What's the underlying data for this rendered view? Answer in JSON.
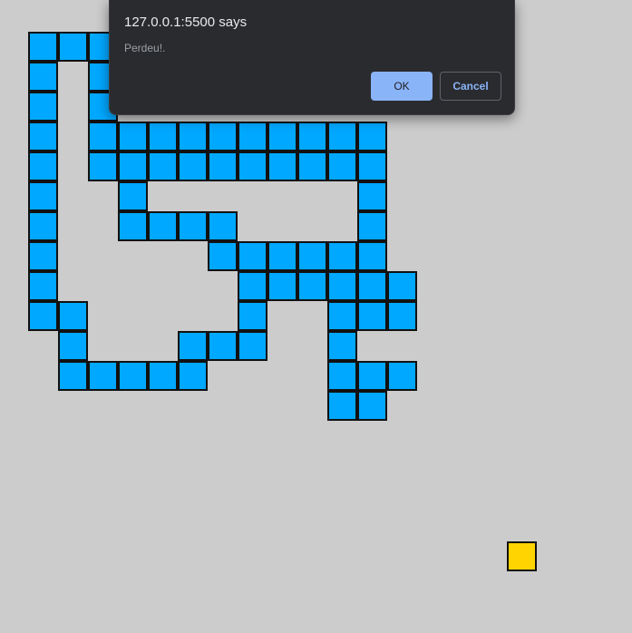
{
  "game": {
    "snake_color": "#00a8ff",
    "food_color": "#ffd400",
    "background_color": "#cccccc",
    "grid_origin": [
      31,
      35
    ],
    "cell_size": 33,
    "snake_cells": [
      [
        0,
        0
      ],
      [
        1,
        0
      ],
      [
        2,
        0
      ],
      [
        0,
        1
      ],
      [
        2,
        1
      ],
      [
        0,
        2
      ],
      [
        2,
        2
      ],
      [
        0,
        3
      ],
      [
        2,
        3
      ],
      [
        3,
        3
      ],
      [
        4,
        3
      ],
      [
        5,
        3
      ],
      [
        6,
        3
      ],
      [
        7,
        3
      ],
      [
        8,
        3
      ],
      [
        9,
        3
      ],
      [
        10,
        3
      ],
      [
        11,
        3
      ],
      [
        0,
        4
      ],
      [
        2,
        4
      ],
      [
        3,
        4
      ],
      [
        4,
        4
      ],
      [
        5,
        4
      ],
      [
        6,
        4
      ],
      [
        7,
        4
      ],
      [
        8,
        4
      ],
      [
        9,
        4
      ],
      [
        10,
        4
      ],
      [
        11,
        4
      ],
      [
        0,
        5
      ],
      [
        3,
        5
      ],
      [
        11,
        5
      ],
      [
        0,
        6
      ],
      [
        3,
        6
      ],
      [
        4,
        6
      ],
      [
        5,
        6
      ],
      [
        6,
        6
      ],
      [
        11,
        6
      ],
      [
        0,
        7
      ],
      [
        6,
        7
      ],
      [
        7,
        7
      ],
      [
        8,
        7
      ],
      [
        9,
        7
      ],
      [
        10,
        7
      ],
      [
        11,
        7
      ],
      [
        0,
        8
      ],
      [
        7,
        8
      ],
      [
        8,
        8
      ],
      [
        9,
        8
      ],
      [
        10,
        8
      ],
      [
        11,
        8
      ],
      [
        12,
        8
      ],
      [
        0,
        9
      ],
      [
        1,
        9
      ],
      [
        7,
        9
      ],
      [
        10,
        9
      ],
      [
        11,
        9
      ],
      [
        12,
        9
      ],
      [
        1,
        10
      ],
      [
        5,
        10
      ],
      [
        6,
        10
      ],
      [
        7,
        10
      ],
      [
        10,
        10
      ],
      [
        1,
        11
      ],
      [
        2,
        11
      ],
      [
        3,
        11
      ],
      [
        4,
        11
      ],
      [
        5,
        11
      ],
      [
        10,
        11
      ],
      [
        11,
        11
      ],
      [
        12,
        11
      ],
      [
        10,
        12
      ],
      [
        11,
        12
      ]
    ],
    "food_cell": [
      16,
      17
    ]
  },
  "dialog": {
    "title": "127.0.0.1:5500 says",
    "message": "Perdeu!.",
    "ok_label": "OK",
    "cancel_label": "Cancel"
  }
}
